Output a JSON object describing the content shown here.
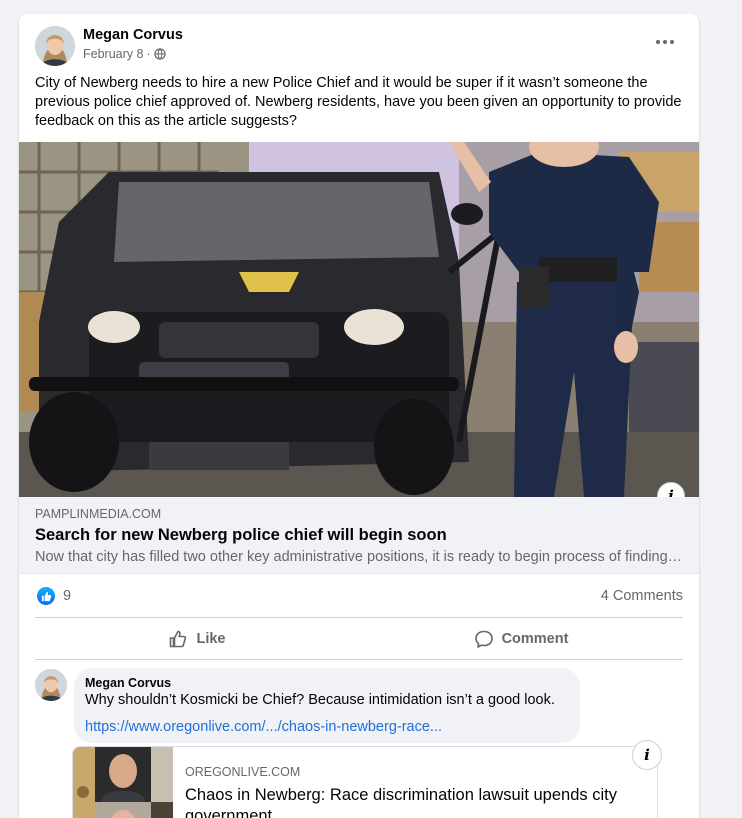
{
  "post": {
    "author": "Megan Corvus",
    "date": "February 8",
    "separator": "·",
    "privacy_icon": "globe-icon",
    "more_icon": "more-options-icon",
    "text": "City of Newberg needs to hire a new Police Chief and it would be super if it wasn’t someone the previous police chief approved of.  Newberg residents, have you been given an opportunity to provide feedback on this as the article suggests?"
  },
  "link_preview": {
    "image_icon": "police-photo",
    "info_label": "i",
    "domain": "PAMPLINMEDIA.COM",
    "title": "Search for new Newberg police chief will begin soon",
    "description": "Now that city has filled two other key administrative positions, it is ready to begin process of finding new police chief"
  },
  "reactions": {
    "icon": "like-icon",
    "count": "9",
    "comments": "4 Comments"
  },
  "actions": {
    "like_label": "Like",
    "comment_label": "Comment"
  },
  "comment": {
    "author": "Megan Corvus",
    "text": "Why shouldn’t Kosmicki be Chief? Because intimidation isn’t a good look.",
    "link": "https://www.oregonlive.com/.../chaos-in-newberg-race..."
  },
  "comment_preview": {
    "info_label": "i",
    "domain": "OREGONLIVE.COM",
    "title": "Chaos in Newberg: Race discrimination lawsuit upends city government"
  },
  "colors": {
    "background": "#f0f2f5",
    "card": "#ffffff",
    "secondary_text": "#65676b",
    "link": "#216fdb",
    "like_blue": "#0b6ef0"
  }
}
